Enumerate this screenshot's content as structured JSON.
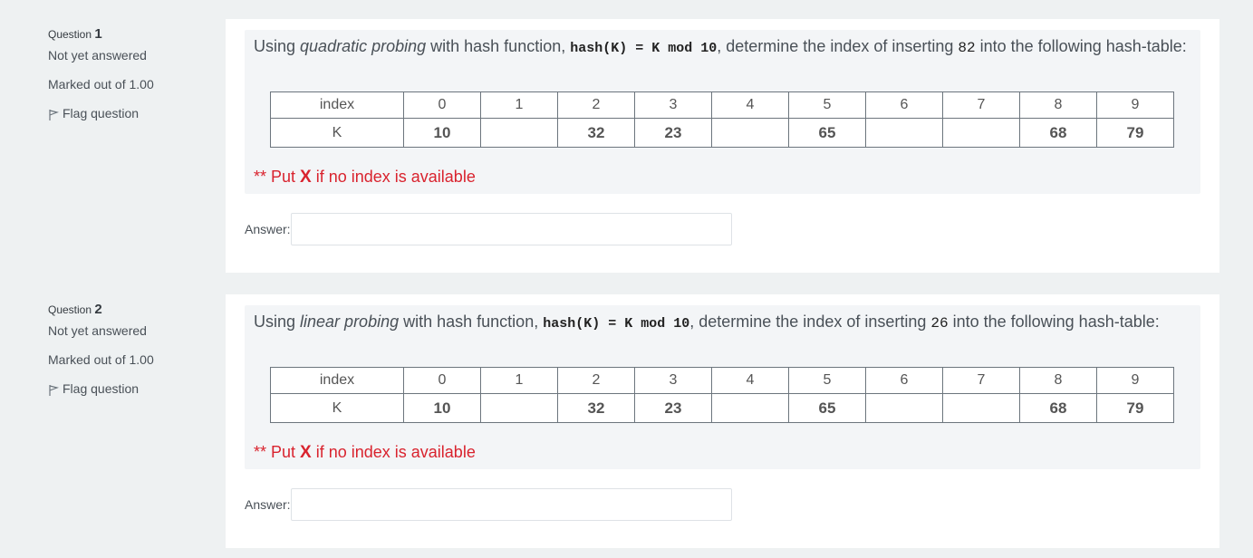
{
  "questions": [
    {
      "label": "Question",
      "number": "1",
      "state": "Not yet answered",
      "grade": "Marked out of 1.00",
      "flag_label": "Flag question",
      "text_before": "Using ",
      "method": "quadratic probing",
      "text_mid": " with hash function, ",
      "hash_fn": "hash(K) = K mod 10",
      "text_mid2": ", determine the index of inserting ",
      "insert_key": "82",
      "text_after": " into the following hash-table:",
      "table": {
        "row_index_label": "index",
        "row_key_label": "K",
        "indices": [
          "0",
          "1",
          "2",
          "3",
          "4",
          "5",
          "6",
          "7",
          "8",
          "9"
        ],
        "keys": [
          "10",
          "",
          "32",
          "23",
          "",
          "65",
          "",
          "",
          "68",
          "79"
        ]
      },
      "note_prefix": "** Put ",
      "note_x": "X",
      "note_suffix": " if no index is available",
      "answer_label": "Answer:",
      "answer_value": ""
    },
    {
      "label": "Question",
      "number": "2",
      "state": "Not yet answered",
      "grade": "Marked out of 1.00",
      "flag_label": "Flag question",
      "text_before": "Using ",
      "method": "linear probing",
      "text_mid": " with hash function, ",
      "hash_fn": "hash(K) = K mod 10",
      "text_mid2": ", determine the index of inserting ",
      "insert_key": "26",
      "text_after": " into the following hash-table:",
      "table": {
        "row_index_label": "index",
        "row_key_label": "K",
        "indices": [
          "0",
          "1",
          "2",
          "3",
          "4",
          "5",
          "6",
          "7",
          "8",
          "9"
        ],
        "keys": [
          "10",
          "",
          "32",
          "23",
          "",
          "65",
          "",
          "",
          "68",
          "79"
        ]
      },
      "note_prefix": "** Put ",
      "note_x": "X",
      "note_suffix": " if no index is available",
      "answer_label": "Answer:",
      "answer_value": ""
    }
  ]
}
